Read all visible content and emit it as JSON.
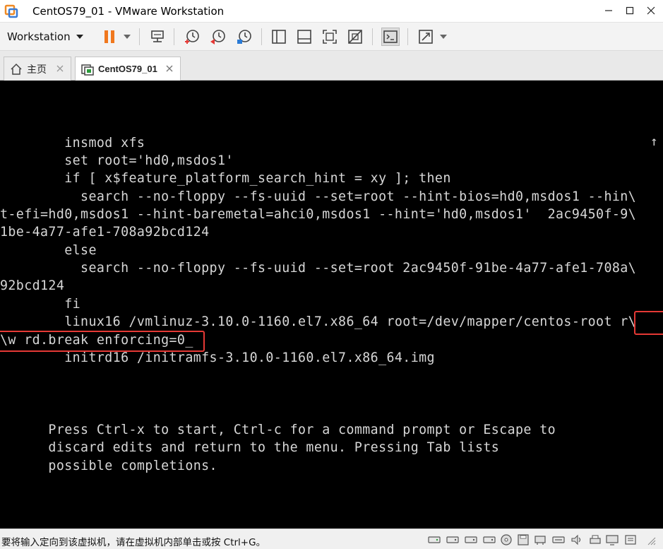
{
  "window": {
    "title": "CentOS79_01 - VMware Workstation"
  },
  "toolbar": {
    "workstation_menu_label": "Workstation"
  },
  "tabs": [
    {
      "label": "主页",
      "active": false
    },
    {
      "label": "CentOS79_01",
      "active": true
    }
  ],
  "console": {
    "lines": [
      "        insmod xfs",
      "        set root='hd0,msdos1'",
      "        if [ x$feature_platform_search_hint = xy ]; then",
      "          search --no-floppy --fs-uuid --set=root --hint-bios=hd0,msdos1 --hin\\",
      "t-efi=hd0,msdos1 --hint-baremetal=ahci0,msdos1 --hint='hd0,msdos1'  2ac9450f-9\\",
      "1be-4a77-afe1-708a92bcd124",
      "        else",
      "          search --no-floppy --fs-uuid --set=root 2ac9450f-91be-4a77-afe1-708a\\",
      "92bcd124",
      "        fi",
      "        linux16 /vmlinuz-3.10.0-1160.el7.x86_64 root=/dev/mapper/centos-root r\\",
      "\\w rd.break enforcing=0_",
      "        initrd16 /initramfs-3.10.0-1160.el7.x86_64.img",
      "",
      "",
      "",
      "      Press Ctrl-x to start, Ctrl-c for a command prompt or Escape to",
      "      discard edits and return to the menu. Pressing Tab lists",
      "      possible completions."
    ],
    "scroll_indicator": "↑"
  },
  "statusbar": {
    "message": "要将输入定向到该虚拟机，请在虚拟机内部单击或按 Ctrl+G。"
  },
  "colors": {
    "console_bg": "#000000",
    "console_text": "#d7d7d7",
    "highlight": "#e53935",
    "pause_orange": "#f0781e"
  }
}
